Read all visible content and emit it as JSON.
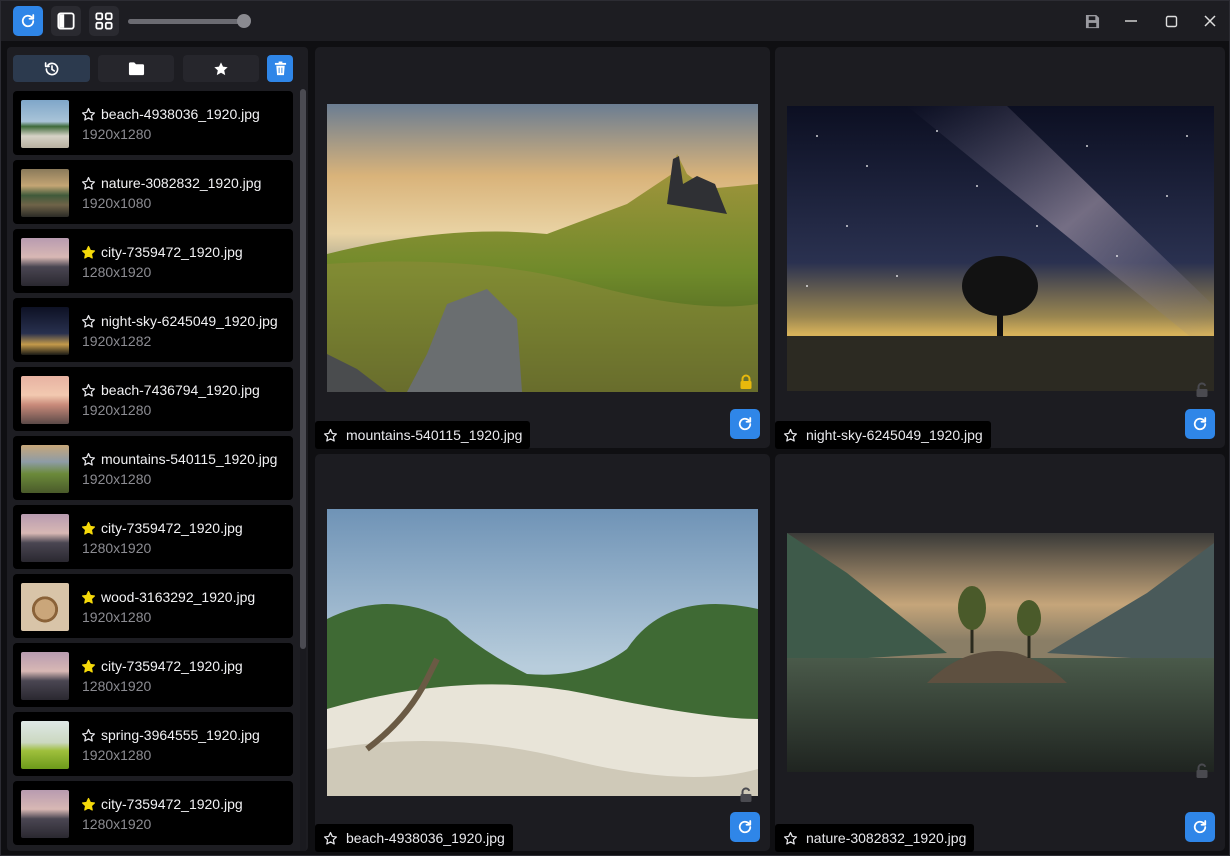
{
  "toolbar": {
    "slider_value_fraction": 0.95
  },
  "sidebar": {
    "tabs": [
      {
        "icon": "history-icon",
        "active": true
      },
      {
        "icon": "folder-icon",
        "active": false
      },
      {
        "icon": "star-icon",
        "active": false
      },
      {
        "icon": "trash-icon",
        "active": false
      }
    ],
    "items": [
      {
        "name": "beach-4938036_1920.jpg",
        "size": "1920x1280",
        "starred": false
      },
      {
        "name": "nature-3082832_1920.jpg",
        "size": "1920x1080",
        "starred": false
      },
      {
        "name": "city-7359472_1920.jpg",
        "size": "1280x1920",
        "starred": true
      },
      {
        "name": "night-sky-6245049_1920.jpg",
        "size": "1920x1282",
        "starred": false
      },
      {
        "name": "beach-7436794_1920.jpg",
        "size": "1920x1280",
        "starred": false
      },
      {
        "name": "mountains-540115_1920.jpg",
        "size": "1920x1280",
        "starred": false
      },
      {
        "name": "city-7359472_1920.jpg",
        "size": "1280x1920",
        "starred": true
      },
      {
        "name": "wood-3163292_1920.jpg",
        "size": "1920x1280",
        "starred": true
      },
      {
        "name": "city-7359472_1920.jpg",
        "size": "1280x1920",
        "starred": true
      },
      {
        "name": "spring-3964555_1920.jpg",
        "size": "1920x1280",
        "starred": false
      },
      {
        "name": "city-7359472_1920.jpg",
        "size": "1280x1920",
        "starred": true
      }
    ]
  },
  "panels": [
    {
      "name": "mountains-540115_1920.jpg",
      "starred": false,
      "locked": true
    },
    {
      "name": "night-sky-6245049_1920.jpg",
      "starred": false,
      "locked": false
    },
    {
      "name": "beach-4938036_1920.jpg",
      "starred": false,
      "locked": false
    },
    {
      "name": "nature-3082832_1920.jpg",
      "starred": false,
      "locked": false
    }
  ],
  "colors": {
    "accent": "#2f86e8",
    "star_active": "#f5d90a",
    "lock_active": "#e8b90c"
  }
}
